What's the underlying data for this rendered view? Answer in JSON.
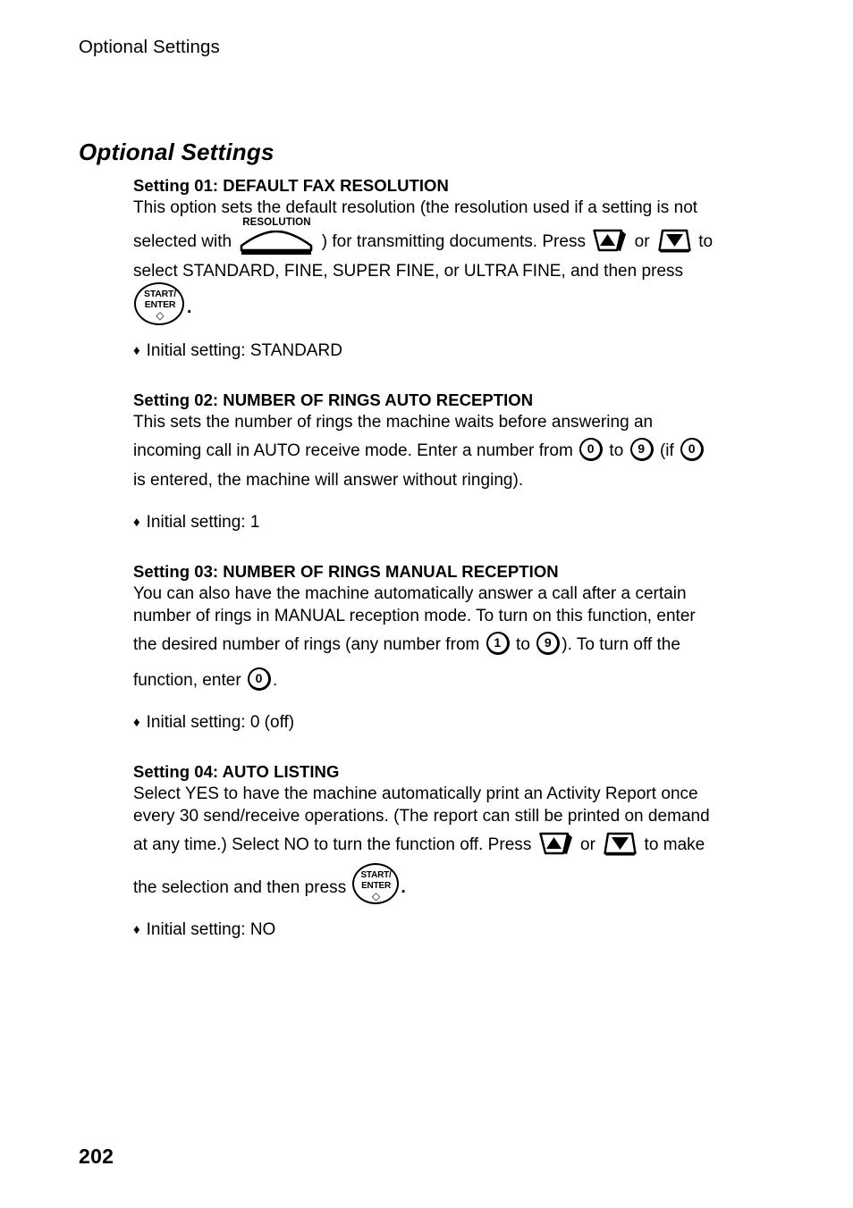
{
  "page": {
    "running_header": "Optional Settings",
    "chapter_title": "Optional Settings",
    "folio": "202"
  },
  "keys": {
    "start_enter": {
      "line1": "START/",
      "line2": "ENTER",
      "glyph": "◇"
    },
    "resolution": {
      "label": "RESOLUTION"
    },
    "arrow_up": {
      "label": "▲"
    },
    "arrow_down": {
      "label": "▼"
    },
    "num_0": "0",
    "num_1": "1",
    "num_9": "9"
  },
  "bullet": "♦",
  "sections": [
    {
      "heading": "Setting 01: DEFAULT FAX RESOLUTION",
      "body": {
        "t1": "This option sets the default resolution (the resolution used if a setting is not",
        "t2": "selected with",
        "t3": ") for transmitting documents. Press",
        "t4": "or",
        "t5": "to",
        "t6": "select STANDARD,  FINE, SUPER FINE, or ULTRA FINE, and then press",
        "t7": "."
      },
      "initial": "Initial setting: STANDARD"
    },
    {
      "heading": "Setting 02: NUMBER OF RINGS AUTO RECEPTION",
      "body": {
        "t1": "This sets the number of rings the machine waits before answering an",
        "t2": "incoming call in AUTO receive mode. Enter a number from",
        "t3": "to",
        "t4": "(if",
        "t5": "is entered, the machine will answer without ringing)."
      },
      "initial": "Initial setting: 1"
    },
    {
      "heading": "Setting 03: NUMBER OF RINGS MANUAL RECEPTION",
      "body": {
        "t1": "You can also have the machine automatically answer a call after a certain",
        "t2": "number of rings in MANUAL reception mode. To turn on this function, enter",
        "t3": "the desired number of rings (any number from",
        "t4": "to",
        "t5": "). To turn off the",
        "t6": "function, enter",
        "t7": "."
      },
      "initial": "Initial setting: 0 (off)"
    },
    {
      "heading": "Setting 04: AUTO LISTING",
      "body": {
        "t1": "Select YES to have the machine automatically print an Activity Report once",
        "t2": "every 30 send/receive operations. (The report can still be printed on demand",
        "t3": "at any time.) Select NO to turn the function off. Press",
        "t4": "or",
        "t5": "to make",
        "t6": "the selection and then press",
        "t7": "."
      },
      "initial": "Initial setting: NO"
    }
  ]
}
